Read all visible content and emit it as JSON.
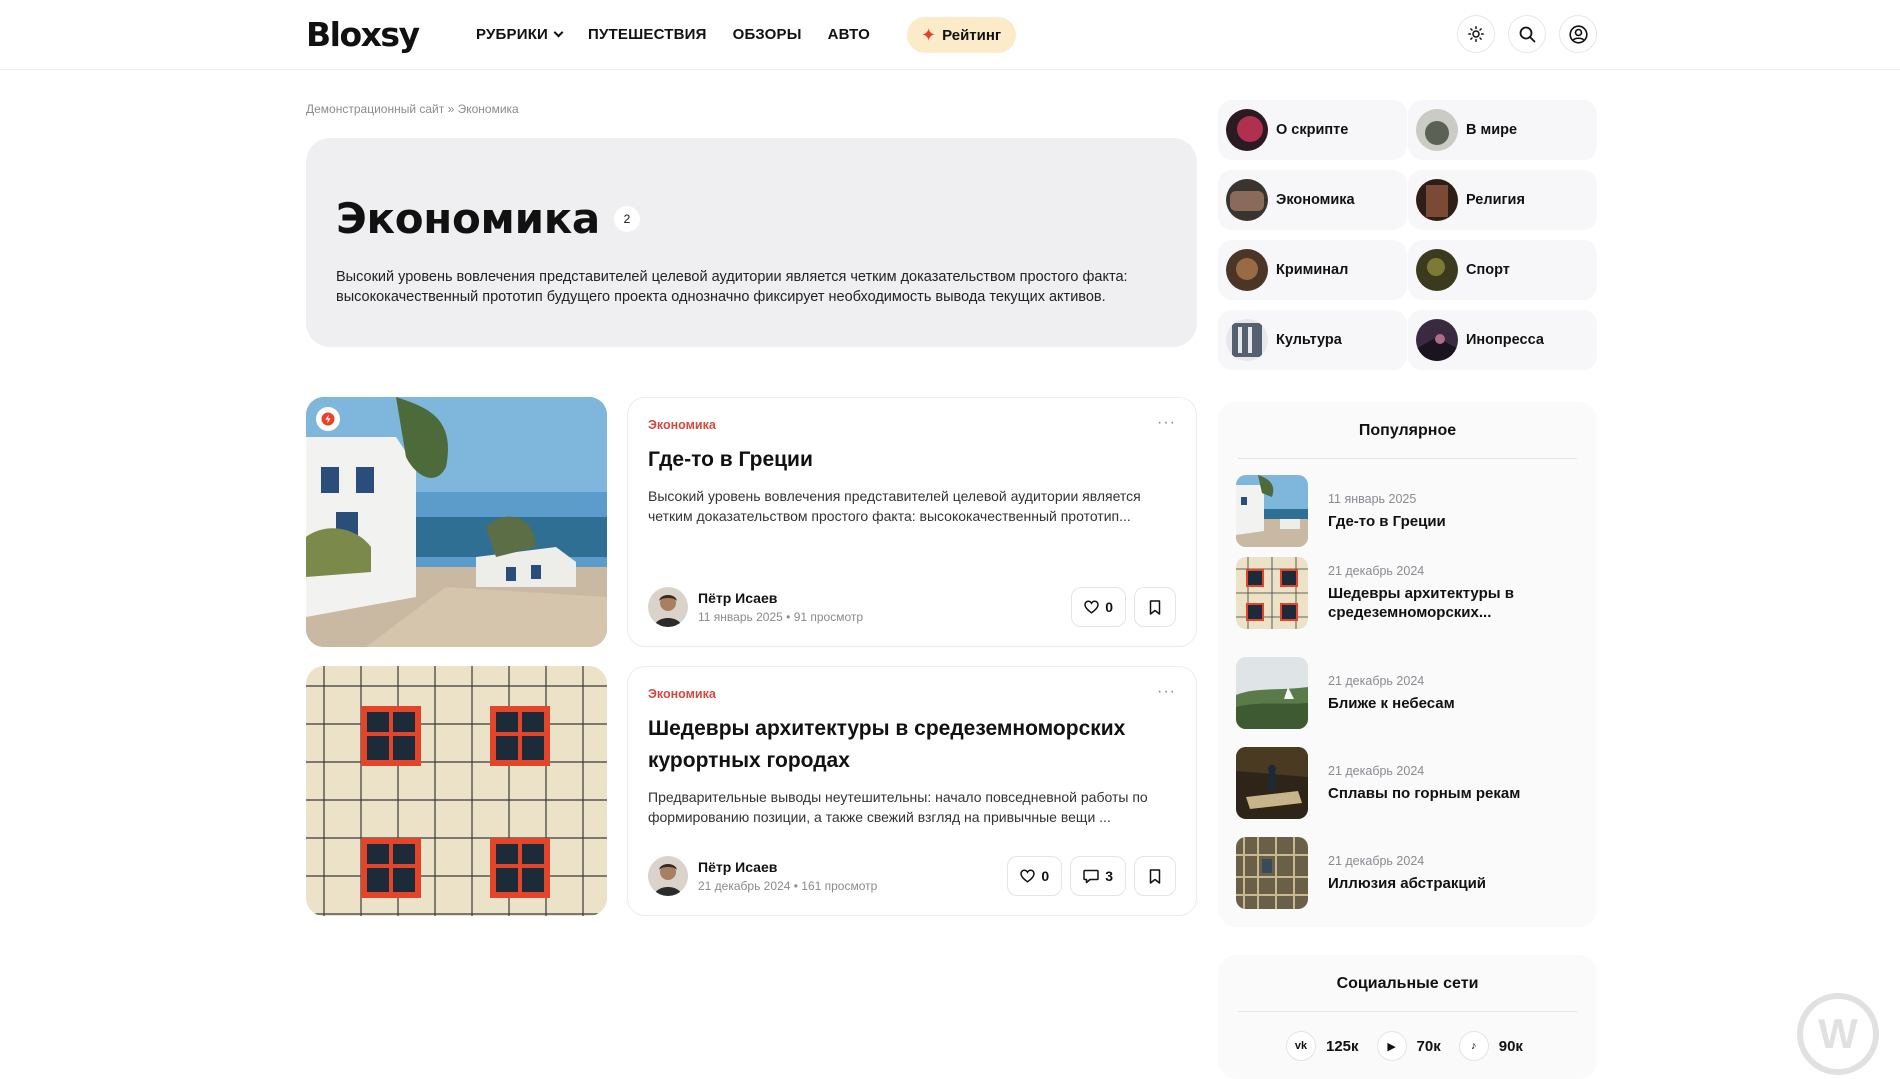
{
  "header": {
    "logo": "Bloxsy",
    "nav": [
      {
        "label": "РУБРИКИ",
        "dropdown": true
      },
      {
        "label": "ПУТЕШЕСТВИЯ",
        "dropdown": false
      },
      {
        "label": "ОБЗОРЫ",
        "dropdown": false
      },
      {
        "label": "АВТО",
        "dropdown": false
      }
    ],
    "rating_label": "Рейтинг",
    "icons": [
      "sun-icon",
      "search-icon",
      "user-icon"
    ]
  },
  "breadcrumb": {
    "home": "Демонстрационный сайт",
    "separator": "»",
    "current": "Экономика"
  },
  "category": {
    "title": "Экономика",
    "count": "2",
    "description_line1": "Высокий уровень вовлечения представителей целевой аудитории является четким доказательством простого факта:",
    "description_line2": "высококачественный прототип будущего проекта однозначно фиксирует необходимость вывода текущих активов."
  },
  "posts": [
    {
      "category": "Экономика",
      "title": "Где-то в Греции",
      "excerpt": "Высокий уровень вовлечения представителей целевой аудитории является четким доказательством простого факта: высококачественный прототип...",
      "author": "Пётр Исаев",
      "date": "11 январь 2025",
      "views": "91 просмотр",
      "likes": "0",
      "comments": null
    },
    {
      "category": "Экономика",
      "title": "Шедевры архитектуры в средеземноморских курортных городах",
      "excerpt": "Предварительные выводы неутешительны: начало повседневной работы по формированию позиции, а также свежий взгляд на привычные вещи ...",
      "author": "Пётр Исаев",
      "date": "21 декабрь 2024",
      "views": "161 просмотр",
      "likes": "0",
      "comments": "3"
    }
  ],
  "meta_separator": "•",
  "sidebar": {
    "categories": [
      {
        "label": "О скрипте",
        "color": "#b03050"
      },
      {
        "label": "В мире",
        "color": "#5b6255"
      },
      {
        "label": "Экономика",
        "color": "#8a6b5a"
      },
      {
        "label": "Религия",
        "color": "#7a4a35"
      },
      {
        "label": "Криминал",
        "color": "#9a6a45"
      },
      {
        "label": "Спорт",
        "color": "#7d7a35"
      },
      {
        "label": "Культура",
        "color": "#556070"
      },
      {
        "label": "Инопресса",
        "color": "#3a2a40"
      }
    ],
    "popular": {
      "title": "Популярное",
      "items": [
        {
          "date": "11 январь 2025",
          "title": "Где-то в Греции"
        },
        {
          "date": "21 декабрь 2024",
          "title": "Шедевры архитектуры в средеземноморских..."
        },
        {
          "date": "21 декабрь 2024",
          "title": "Ближе к небесам"
        },
        {
          "date": "21 декабрь 2024",
          "title": "Сплавы по горным рекам"
        },
        {
          "date": "21 декабрь 2024",
          "title": "Иллюзия абстракций"
        }
      ]
    },
    "social": {
      "title": "Социальные сети",
      "items": [
        {
          "icon": "vk-icon",
          "glyph": "vk",
          "count": "125к"
        },
        {
          "icon": "youtube-icon",
          "glyph": "▶",
          "count": "70к"
        },
        {
          "icon": "tiktok-icon",
          "glyph": "♪",
          "count": "90к"
        }
      ]
    }
  },
  "watermark": "W",
  "colors": {
    "accent": "#d24a3e",
    "rating_bg": "#fcebc8",
    "hero_bg": "#efeff2",
    "spark": "#e8412c"
  }
}
